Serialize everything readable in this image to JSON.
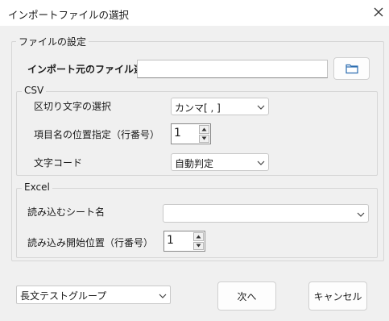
{
  "window": {
    "title": "インポートファイルの選択"
  },
  "file_settings": {
    "legend": "ファイルの設定",
    "source_label": "インポート元のファイル選択",
    "source_value": "",
    "browse_icon": "folder-icon"
  },
  "csv": {
    "legend": "CSV",
    "delimiter_label": "区切り文字の選択",
    "delimiter_value": "カンマ[ , ]",
    "header_row_label": "項目名の位置指定（行番号）",
    "header_row_value": "1",
    "encoding_label": "文字コード",
    "encoding_value": "自動判定"
  },
  "excel": {
    "legend": "Excel",
    "sheet_label": "読み込むシート名",
    "sheet_value": "",
    "start_row_label": "読み込み開始位置（行番号）",
    "start_row_value": "1"
  },
  "footer": {
    "group_value": "長文テストグループ",
    "next_label": "次へ",
    "cancel_label": "キャンセル"
  }
}
